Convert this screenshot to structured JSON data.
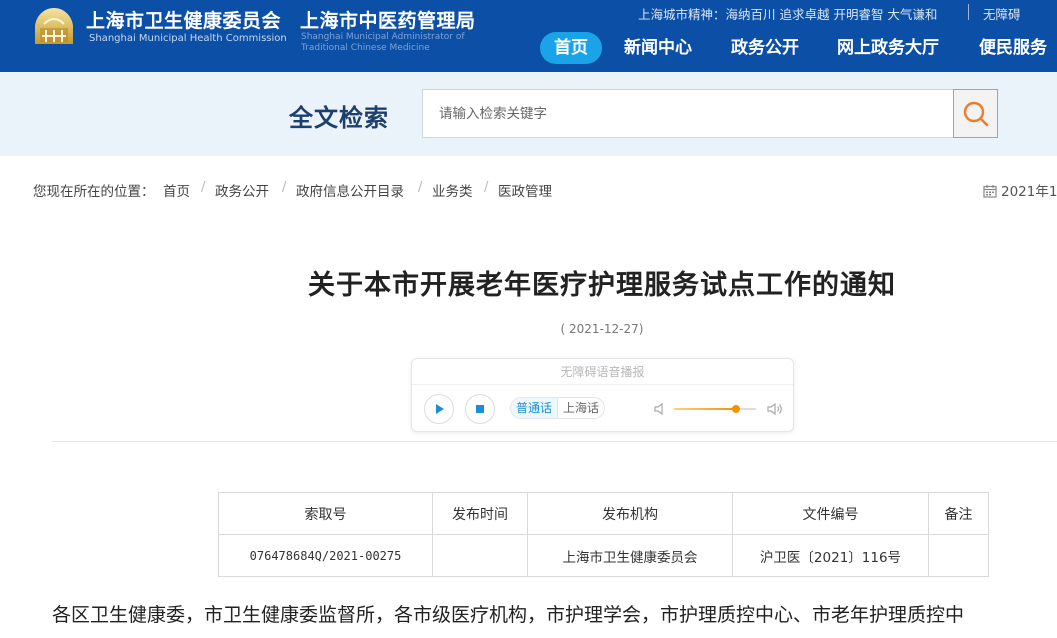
{
  "header": {
    "org1_cn": "上海市卫生健康委员会",
    "org1_en": "Shanghai Municipal Health Commission",
    "org2_cn": "上海市中医药管理局",
    "org2_en": "Shanghai Municipal Administrator of Traditional Chinese Medicine",
    "city_spirit": "上海城市精神：海纳百川 追求卓越 开明睿智 大气谦和",
    "accessibility_label": "无障碍",
    "nav": [
      {
        "label": "首页",
        "active": true
      },
      {
        "label": "新闻中心",
        "active": false
      },
      {
        "label": "政务公开",
        "active": false
      },
      {
        "label": "网上政务大厅",
        "active": false
      },
      {
        "label": "便民服务",
        "active": false
      }
    ]
  },
  "search": {
    "title": "全文检索",
    "placeholder": "请输入检索关键字",
    "icon": "search-icon"
  },
  "breadcrumb": {
    "prefix": "您现在所在的位置：",
    "items": [
      "首页",
      "政务公开",
      "政府信息公开目录",
      "业务类",
      "医政管理"
    ],
    "separator": "/",
    "date": "2021年1"
  },
  "article": {
    "title": "关于本市开展老年医疗护理服务试点工作的通知",
    "date": "( 2021-12-27)"
  },
  "player": {
    "label": "无障碍语音播报",
    "lang_mandarin": "普通话",
    "lang_shanghai": "上海话",
    "volume_level": 0.76
  },
  "meta_table": {
    "headers": [
      "索取号",
      "发布时间",
      "发布机构",
      "文件编号",
      "备注"
    ],
    "row": [
      "076478684Q/2021-00275",
      "",
      "上海市卫生健康委员会",
      "沪卫医〔2021〕116号",
      ""
    ]
  },
  "body_text": "各区卫生健康委，市卫生健康委监督所，各市级医疗机构，市护理学会，市护理质控中心、市老年护理质控中",
  "colors": {
    "header_bg": "#0b4fa6",
    "nav_active_bg": "#1aa3e8",
    "search_band_bg": "#eaf2fa",
    "search_icon": "#f07b2a",
    "player_accent": "#1a8fd6"
  }
}
